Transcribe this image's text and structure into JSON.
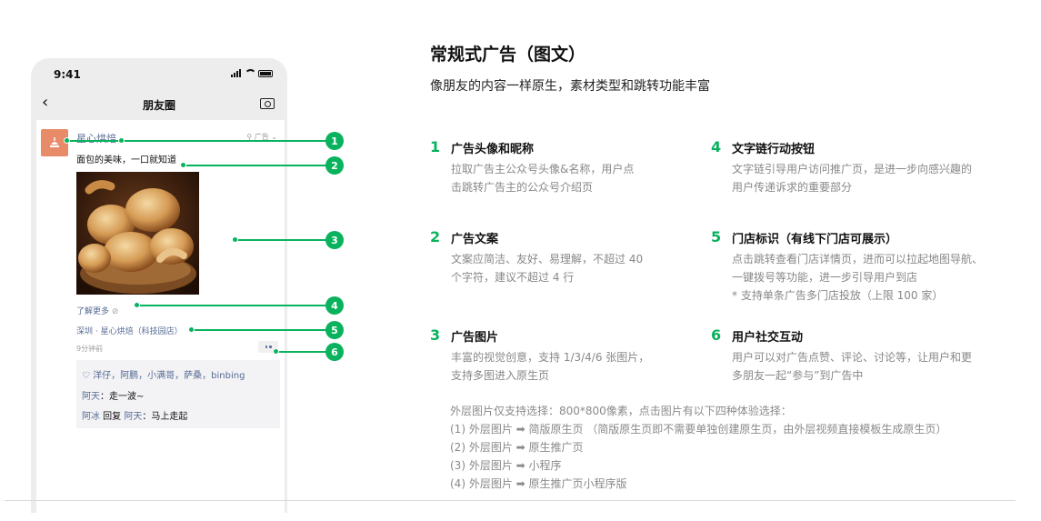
{
  "phone": {
    "status_time": "9:41",
    "nav_title": "朋友圈",
    "nav_back_icon": "chevron-left-icon",
    "nav_camera_icon": "camera-icon",
    "post": {
      "nickname": "星心烘焙",
      "ad_tag": "广告",
      "text": "面包的美味，一口就知道",
      "learn_more": "了解更多",
      "store": "深圳 · 星心烘焙（科技园店）",
      "time_ago": "9分钟前",
      "likes": "洋仔，阿鹏，小满哥，萨桑，binbing",
      "comments": [
        {
          "user": "阿天",
          "sep": "：",
          "text": "走一波~"
        },
        {
          "user": "阿冰",
          "reply_word": " 回复 ",
          "reply_to": "阿天",
          "sep": "：",
          "text": "马上走起"
        }
      ]
    }
  },
  "callouts": [
    "1",
    "2",
    "3",
    "4",
    "5",
    "6"
  ],
  "title": "常规式广告（图文）",
  "subtitle": "像朋友的内容一样原生，素材类型和跳转功能丰富",
  "features": [
    {
      "num": "1",
      "title": "广告头像和昵称",
      "desc": [
        "拉取广告主公众号头像&名称，用户点",
        "击跳转广告主的公众号介绍页"
      ]
    },
    {
      "num": "2",
      "title": "广告文案",
      "desc": [
        "文案应简洁、友好、易理解，不超过 40",
        "个字符，建议不超过 4 行"
      ]
    },
    {
      "num": "3",
      "title": "广告图片",
      "desc": [
        "丰富的视觉创意，支持 1/3/4/6 张图片，",
        "支持多图进入原生页"
      ]
    },
    {
      "num": "4",
      "title": "文字链行动按钮",
      "desc": [
        "文字链引导用户访问推广页，是进一步向感兴趣的",
        "用户传递诉求的重要部分"
      ]
    },
    {
      "num": "5",
      "title": "门店标识（有线下门店可展示）",
      "desc": [
        "点击跳转查看门店详情页，进而可以拉起地图导航、",
        "一键拨号等功能，进一步引导用户到店",
        "* 支持单条广告多门店投放（上限 100 家）"
      ]
    },
    {
      "num": "6",
      "title": "用户社交互动",
      "desc": [
        "用户可以对广告点赞、评论、讨论等，让用户和更",
        "多朋友一起“参与”到广告中"
      ]
    }
  ],
  "notes": [
    "外层图片仅支持选择：800*800像素，点击图片有以下四种体验选择：",
    "(1) 外层图片 ➡ 简版原生页 （简版原生页即不需要单独创建原生页，由外层视频直接模板生成原生页）",
    "(2) 外层图片 ➡ 原生推广页",
    "(3) 外层图片 ➡ 小程序",
    "(4) 外层图片 ➡ 原生推广页小程序版"
  ],
  "colors": {
    "accent": "#09b35e",
    "link": "#576b95",
    "avatar": "#e88b68"
  }
}
